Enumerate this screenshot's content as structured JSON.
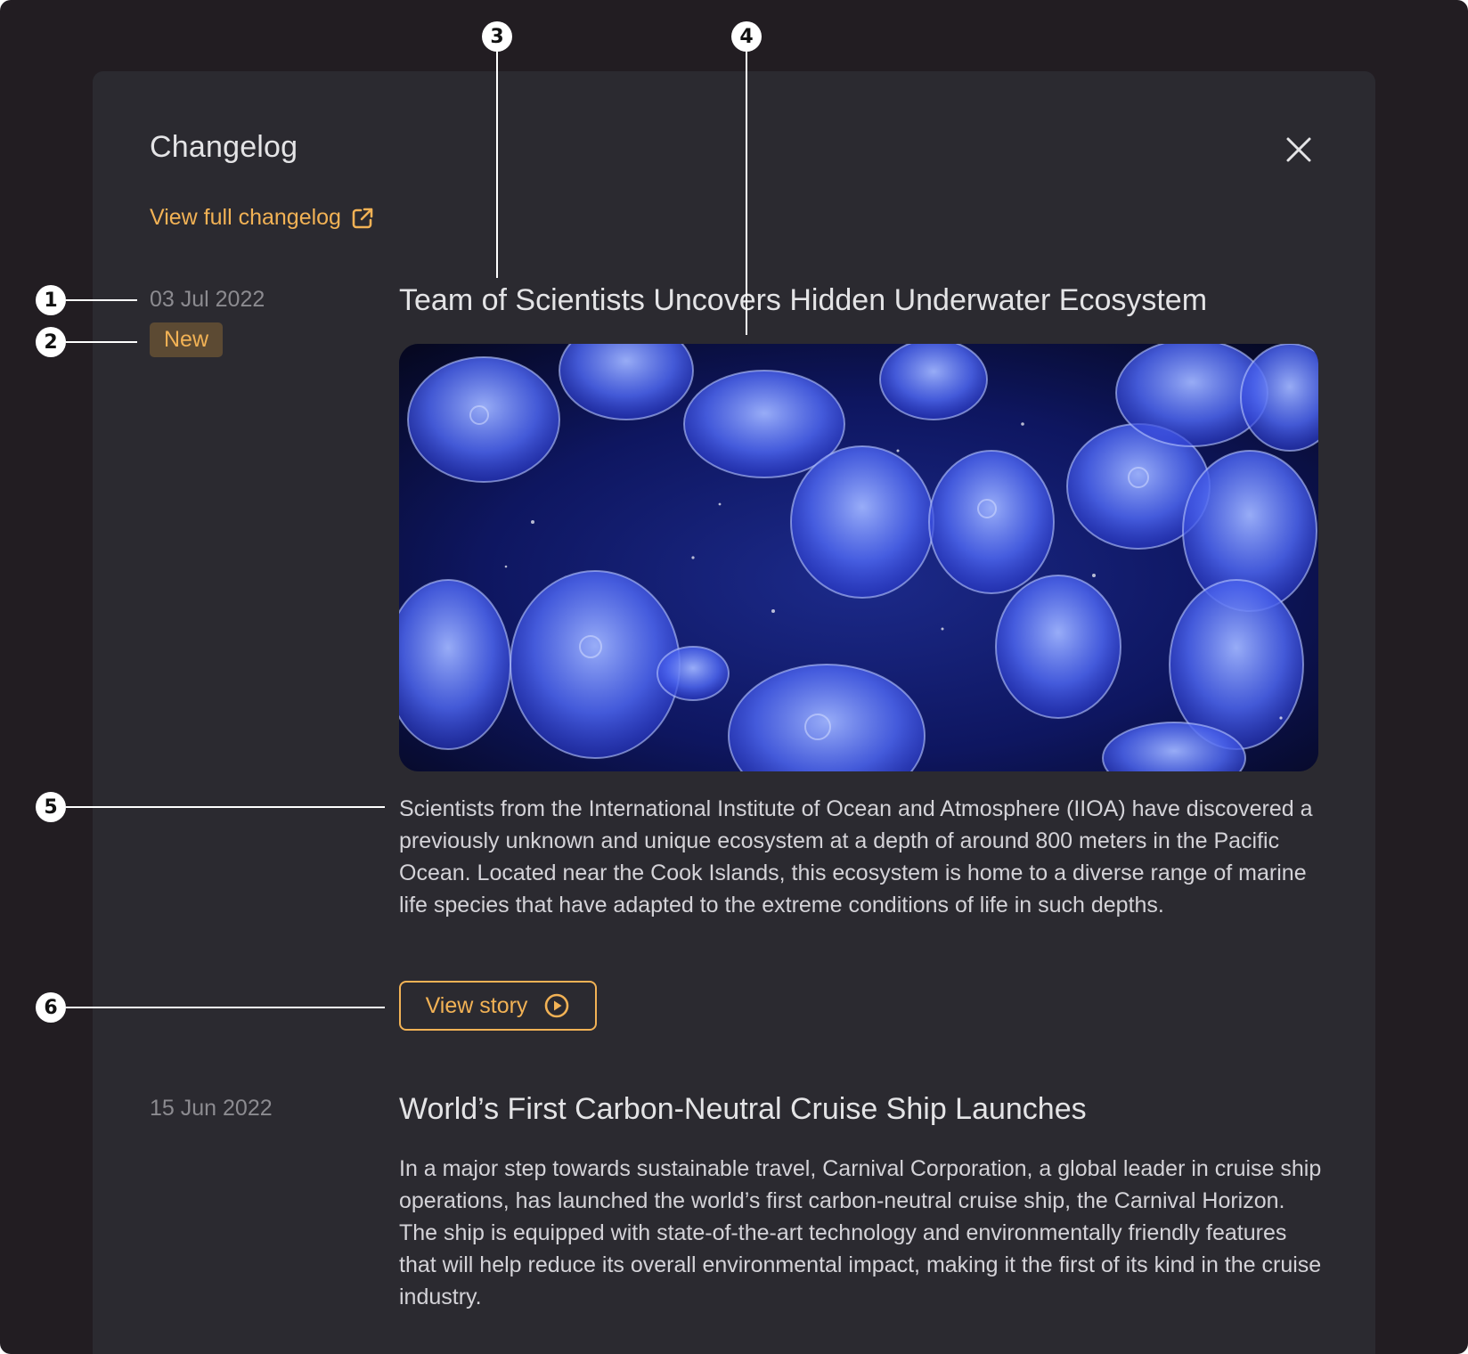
{
  "dialog": {
    "title": "Changelog",
    "full_changelog_link": "View full changelog"
  },
  "entries": [
    {
      "date": "03 Jul 2022",
      "badge": "New",
      "headline": "Team of Scientists Uncovers Hidden Underwater Ecosystem",
      "image": "jellyfish-photo",
      "body": "Scientists from the International Institute of Ocean and Atmosphere (IIOA) have discovered a previously unknown and unique ecosystem at a depth of around 800 meters in the Pacific Ocean. Located near the Cook Islands, this ecosystem is home to a diverse range of marine life species that have adapted to the extreme conditions of life in such depths.",
      "button": "View story"
    },
    {
      "date": "15 Jun 2022",
      "headline": "World’s First Carbon-Neutral Cruise Ship Launches",
      "body": "In a major step towards sustainable travel, Carnival Corporation, a global leader in cruise ship operations, has launched the world’s first carbon-neutral cruise ship, the Carnival Horizon. The ship is equipped with state-of-the-art technology and environmentally friendly features that will help reduce its overall environmental impact, making it the first of its kind in the cruise industry."
    }
  ],
  "callouts": [
    "1",
    "2",
    "3",
    "4",
    "5",
    "6"
  ],
  "colors": {
    "accent": "#f2b255",
    "panel": "#2b2a30",
    "background": "#221d22",
    "badge_bg": "#5c4a33"
  },
  "icons": [
    "close-icon",
    "external-link-icon",
    "play-circle-icon"
  ]
}
